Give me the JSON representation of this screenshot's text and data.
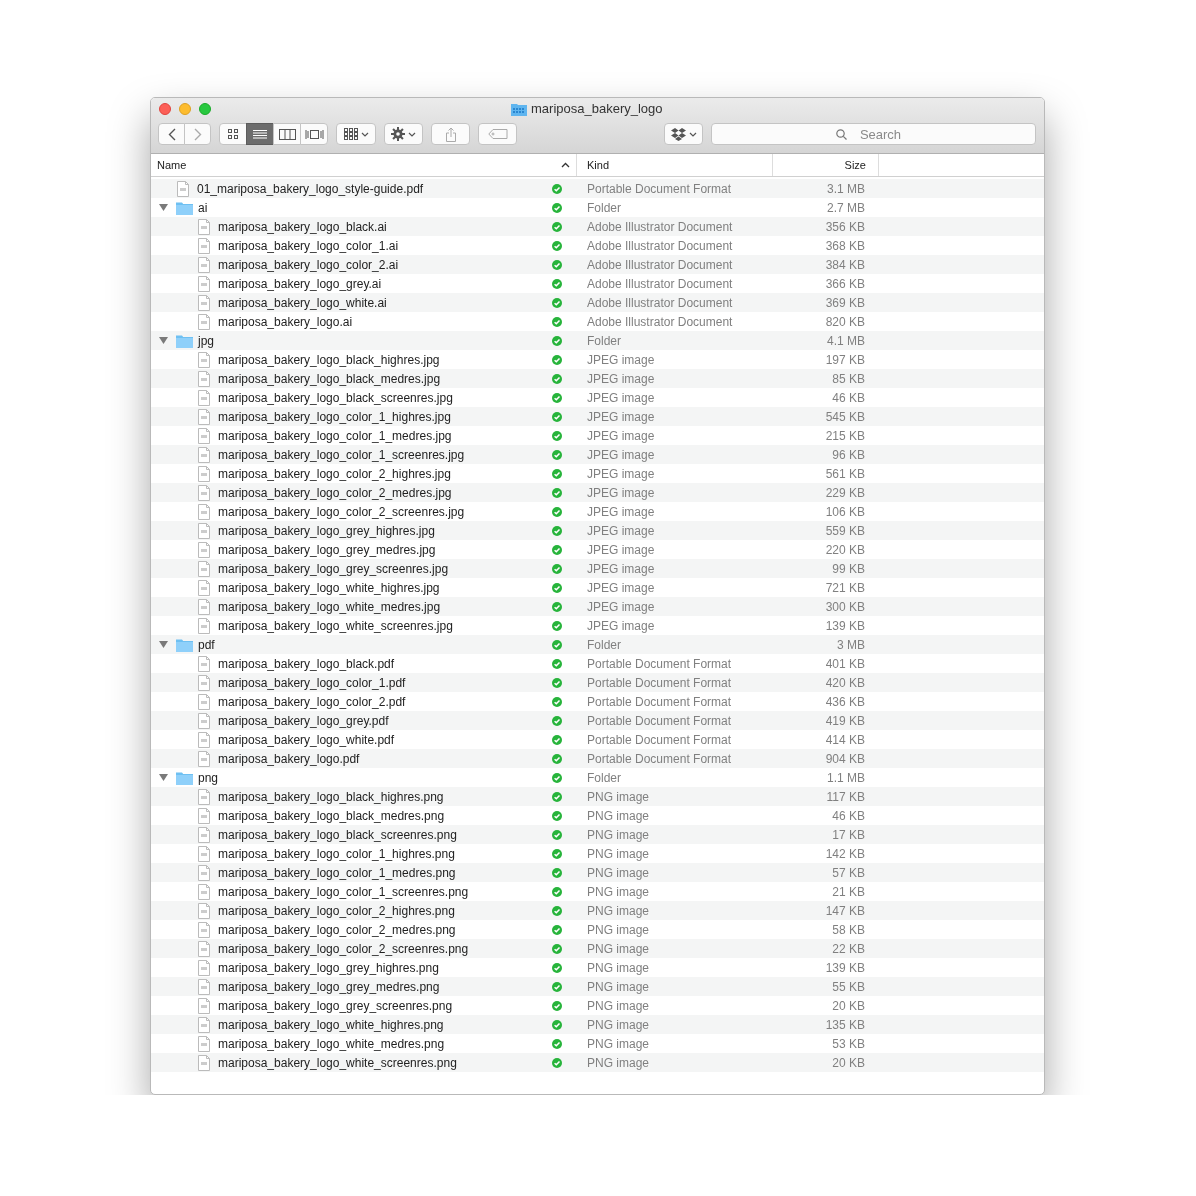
{
  "window": {
    "title": "mariposa_bakery_logo"
  },
  "toolbar": {
    "view_modes": [
      {
        "selected": false
      },
      {
        "selected": true
      },
      {
        "selected": false
      },
      {
        "selected": false
      }
    ],
    "search": {
      "placeholder": "Search"
    }
  },
  "columns": [
    {
      "label": "Name",
      "sorted": true
    },
    {
      "label": "Kind",
      "sorted": false
    },
    {
      "label": "Size",
      "sorted": false
    }
  ],
  "items": [
    {
      "kind": "file",
      "name": "01_mariposa_bakery_logo_style-guide.pdf",
      "synced": true,
      "type": "Portable Document Format",
      "size": "3.1 MB"
    },
    {
      "kind": "folder",
      "name": "ai",
      "expanded": true,
      "synced": true,
      "type": "Folder",
      "size": "2.7 MB",
      "children": [
        {
          "kind": "file",
          "name": "mariposa_bakery_logo_black.ai",
          "synced": true,
          "type": "Adobe Illustrator Document",
          "size": "356 KB"
        },
        {
          "kind": "file",
          "name": "mariposa_bakery_logo_color_1.ai",
          "synced": true,
          "type": "Adobe Illustrator Document",
          "size": "368 KB"
        },
        {
          "kind": "file",
          "name": "mariposa_bakery_logo_color_2.ai",
          "synced": true,
          "type": "Adobe Illustrator Document",
          "size": "384 KB"
        },
        {
          "kind": "file",
          "name": "mariposa_bakery_logo_grey.ai",
          "synced": true,
          "type": "Adobe Illustrator Document",
          "size": "366 KB"
        },
        {
          "kind": "file",
          "name": "mariposa_bakery_logo_white.ai",
          "synced": true,
          "type": "Adobe Illustrator Document",
          "size": "369 KB"
        },
        {
          "kind": "file",
          "name": "mariposa_bakery_logo.ai",
          "synced": true,
          "type": "Adobe Illustrator Document",
          "size": "820 KB"
        }
      ]
    },
    {
      "kind": "folder",
      "name": "jpg",
      "expanded": true,
      "synced": true,
      "type": "Folder",
      "size": "4.1 MB",
      "children": [
        {
          "kind": "file",
          "name": "mariposa_bakery_logo_black_highres.jpg",
          "synced": true,
          "type": "JPEG image",
          "size": "197 KB"
        },
        {
          "kind": "file",
          "name": "mariposa_bakery_logo_black_medres.jpg",
          "synced": true,
          "type": "JPEG image",
          "size": "85 KB"
        },
        {
          "kind": "file",
          "name": "mariposa_bakery_logo_black_screenres.jpg",
          "synced": true,
          "type": "JPEG image",
          "size": "46 KB"
        },
        {
          "kind": "file",
          "name": "mariposa_bakery_logo_color_1_highres.jpg",
          "synced": true,
          "type": "JPEG image",
          "size": "545 KB"
        },
        {
          "kind": "file",
          "name": "mariposa_bakery_logo_color_1_medres.jpg",
          "synced": true,
          "type": "JPEG image",
          "size": "215 KB"
        },
        {
          "kind": "file",
          "name": "mariposa_bakery_logo_color_1_screenres.jpg",
          "synced": true,
          "type": "JPEG image",
          "size": "96 KB"
        },
        {
          "kind": "file",
          "name": "mariposa_bakery_logo_color_2_highres.jpg",
          "synced": true,
          "type": "JPEG image",
          "size": "561 KB"
        },
        {
          "kind": "file",
          "name": "mariposa_bakery_logo_color_2_medres.jpg",
          "synced": true,
          "type": "JPEG image",
          "size": "229 KB"
        },
        {
          "kind": "file",
          "name": "mariposa_bakery_logo_color_2_screenres.jpg",
          "synced": true,
          "type": "JPEG image",
          "size": "106 KB"
        },
        {
          "kind": "file",
          "name": "mariposa_bakery_logo_grey_highres.jpg",
          "synced": true,
          "type": "JPEG image",
          "size": "559 KB"
        },
        {
          "kind": "file",
          "name": "mariposa_bakery_logo_grey_medres.jpg",
          "synced": true,
          "type": "JPEG image",
          "size": "220 KB"
        },
        {
          "kind": "file",
          "name": "mariposa_bakery_logo_grey_screenres.jpg",
          "synced": true,
          "type": "JPEG image",
          "size": "99 KB"
        },
        {
          "kind": "file",
          "name": "mariposa_bakery_logo_white_highres.jpg",
          "synced": true,
          "type": "JPEG image",
          "size": "721 KB"
        },
        {
          "kind": "file",
          "name": "mariposa_bakery_logo_white_medres.jpg",
          "synced": true,
          "type": "JPEG image",
          "size": "300 KB"
        },
        {
          "kind": "file",
          "name": "mariposa_bakery_logo_white_screenres.jpg",
          "synced": true,
          "type": "JPEG image",
          "size": "139 KB"
        }
      ]
    },
    {
      "kind": "folder",
      "name": "pdf",
      "expanded": true,
      "synced": true,
      "type": "Folder",
      "size": "3 MB",
      "children": [
        {
          "kind": "file",
          "name": "mariposa_bakery_logo_black.pdf",
          "synced": true,
          "type": "Portable Document Format",
          "size": "401 KB"
        },
        {
          "kind": "file",
          "name": "mariposa_bakery_logo_color_1.pdf",
          "synced": true,
          "type": "Portable Document Format",
          "size": "420 KB"
        },
        {
          "kind": "file",
          "name": "mariposa_bakery_logo_color_2.pdf",
          "synced": true,
          "type": "Portable Document Format",
          "size": "436 KB"
        },
        {
          "kind": "file",
          "name": "mariposa_bakery_logo_grey.pdf",
          "synced": true,
          "type": "Portable Document Format",
          "size": "419 KB"
        },
        {
          "kind": "file",
          "name": "mariposa_bakery_logo_white.pdf",
          "synced": true,
          "type": "Portable Document Format",
          "size": "414 KB"
        },
        {
          "kind": "file",
          "name": "mariposa_bakery_logo.pdf",
          "synced": true,
          "type": "Portable Document Format",
          "size": "904 KB"
        }
      ]
    },
    {
      "kind": "folder",
      "name": "png",
      "expanded": true,
      "synced": true,
      "type": "Folder",
      "size": "1.1 MB",
      "children": [
        {
          "kind": "file",
          "name": "mariposa_bakery_logo_black_highres.png",
          "synced": true,
          "type": "PNG image",
          "size": "117 KB"
        },
        {
          "kind": "file",
          "name": "mariposa_bakery_logo_black_medres.png",
          "synced": true,
          "type": "PNG image",
          "size": "46 KB"
        },
        {
          "kind": "file",
          "name": "mariposa_bakery_logo_black_screenres.png",
          "synced": true,
          "type": "PNG image",
          "size": "17 KB"
        },
        {
          "kind": "file",
          "name": "mariposa_bakery_logo_color_1_highres.png",
          "synced": true,
          "type": "PNG image",
          "size": "142 KB"
        },
        {
          "kind": "file",
          "name": "mariposa_bakery_logo_color_1_medres.png",
          "synced": true,
          "type": "PNG image",
          "size": "57 KB"
        },
        {
          "kind": "file",
          "name": "mariposa_bakery_logo_color_1_screenres.png",
          "synced": true,
          "type": "PNG image",
          "size": "21 KB"
        },
        {
          "kind": "file",
          "name": "mariposa_bakery_logo_color_2_highres.png",
          "synced": true,
          "type": "PNG image",
          "size": "147 KB"
        },
        {
          "kind": "file",
          "name": "mariposa_bakery_logo_color_2_medres.png",
          "synced": true,
          "type": "PNG image",
          "size": "58 KB"
        },
        {
          "kind": "file",
          "name": "mariposa_bakery_logo_color_2_screenres.png",
          "synced": true,
          "type": "PNG image",
          "size": "22 KB"
        },
        {
          "kind": "file",
          "name": "mariposa_bakery_logo_grey_highres.png",
          "synced": true,
          "type": "PNG image",
          "size": "139 KB"
        },
        {
          "kind": "file",
          "name": "mariposa_bakery_logo_grey_medres.png",
          "synced": true,
          "type": "PNG image",
          "size": "55 KB"
        },
        {
          "kind": "file",
          "name": "mariposa_bakery_logo_grey_screenres.png",
          "synced": true,
          "type": "PNG image",
          "size": "20 KB"
        },
        {
          "kind": "file",
          "name": "mariposa_bakery_logo_white_highres.png",
          "synced": true,
          "type": "PNG image",
          "size": "135 KB"
        },
        {
          "kind": "file",
          "name": "mariposa_bakery_logo_white_medres.png",
          "synced": true,
          "type": "PNG image",
          "size": "53 KB"
        },
        {
          "kind": "file",
          "name": "mariposa_bakery_logo_white_screenres.png",
          "synced": true,
          "type": "PNG image",
          "size": "20 KB"
        }
      ]
    }
  ]
}
